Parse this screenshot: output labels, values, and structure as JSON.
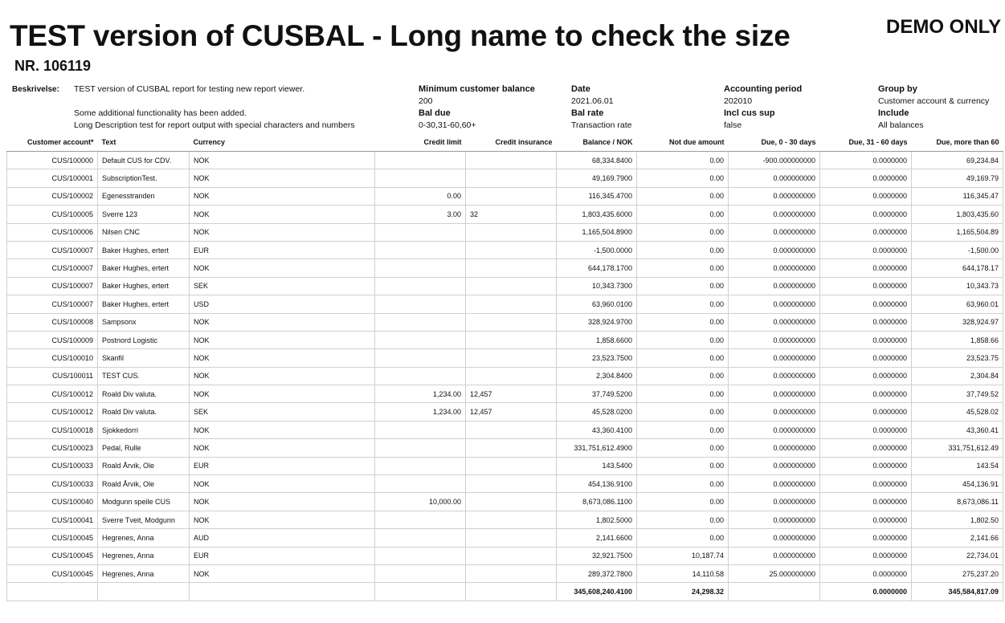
{
  "report": {
    "title": "TEST version of CUSBAL - Long name to check the size",
    "demo_label": "DEMO ONLY",
    "number": "NR. 106119"
  },
  "header": {
    "description_label": "Beskrivelse:",
    "description_lines": [
      "TEST version of CUSBAL report for testing new report viewer.",
      "",
      "Some additional functionality has been added.",
      "Long Description test for report output with special characters and numbers"
    ],
    "min_balance_label": "Minimum customer balance",
    "min_balance_value": "200",
    "bal_due_label": "Bal due",
    "bal_due_value": "0-30,31-60,60+",
    "date_label": "Date",
    "date_value": "2021.06.01",
    "bal_rate_label": "Bal rate",
    "bal_rate_value": "Transaction rate",
    "accounting_period_label": "Accounting period",
    "accounting_period_value": "202010",
    "incl_cus_sup_label": "Incl cus sup",
    "incl_cus_sup_value": "false",
    "group_by_label": "Group by",
    "group_by_value": "Customer account & currency",
    "include_label": "Include",
    "include_value": "All balances"
  },
  "table": {
    "columns": [
      "Customer account*",
      "Text",
      "Currency",
      "Credit limit",
      "Credit insurance",
      "Balance / NOK",
      "Not due amount",
      "Due, 0 - 30 days",
      "Due, 31 - 60 days",
      "Due, more than 60"
    ],
    "rows": [
      [
        "CUS/100000",
        "Default CUS for CDV.",
        "NOK",
        "",
        "",
        "68,334.8400",
        "0.00",
        "-900.000000000",
        "0.0000000",
        "69,234.84"
      ],
      [
        "CUS/100001",
        "SubscriptionTest.",
        "NOK",
        "",
        "",
        "49,169.7900",
        "0.00",
        "0.000000000",
        "0.0000000",
        "49,169.79"
      ],
      [
        "CUS/100002",
        "Egenesstranden",
        "NOK",
        "0.00",
        "",
        "116,345.4700",
        "0.00",
        "0.000000000",
        "0.0000000",
        "116,345.47"
      ],
      [
        "CUS/100005",
        "Sverre 123",
        "NOK",
        "3.00",
        "32",
        "1,803,435.6000",
        "0.00",
        "0.000000000",
        "0.0000000",
        "1,803,435.60"
      ],
      [
        "CUS/100006",
        "Nilsen CNC",
        "NOK",
        "",
        "",
        "1,165,504.8900",
        "0.00",
        "0.000000000",
        "0.0000000",
        "1,165,504.89"
      ],
      [
        "CUS/100007",
        "Baker Hughes, ertert",
        "EUR",
        "",
        "",
        "-1,500.0000",
        "0.00",
        "0.000000000",
        "0.0000000",
        "-1,500.00"
      ],
      [
        "CUS/100007",
        "Baker Hughes, ertert",
        "NOK",
        "",
        "",
        "644,178.1700",
        "0.00",
        "0.000000000",
        "0.0000000",
        "644,178.17"
      ],
      [
        "CUS/100007",
        "Baker Hughes, ertert",
        "SEK",
        "",
        "",
        "10,343.7300",
        "0.00",
        "0.000000000",
        "0.0000000",
        "10,343.73"
      ],
      [
        "CUS/100007",
        "Baker Hughes, ertert",
        "USD",
        "",
        "",
        "63,960.0100",
        "0.00",
        "0.000000000",
        "0.0000000",
        "63,960.01"
      ],
      [
        "CUS/100008",
        "Sampsonx",
        "NOK",
        "",
        "",
        "328,924.9700",
        "0.00",
        "0.000000000",
        "0.0000000",
        "328,924.97"
      ],
      [
        "CUS/100009",
        "Postnord Logistic",
        "NOK",
        "",
        "",
        "1,858.6600",
        "0.00",
        "0.000000000",
        "0.0000000",
        "1,858.66"
      ],
      [
        "CUS/100010",
        "Skanfil",
        "NOK",
        "",
        "",
        "23,523.7500",
        "0.00",
        "0.000000000",
        "0.0000000",
        "23,523.75"
      ],
      [
        "CUS/100011",
        "TEST CUS.",
        "NOK",
        "",
        "",
        "2,304.8400",
        "0.00",
        "0.000000000",
        "0.0000000",
        "2,304.84"
      ],
      [
        "CUS/100012",
        "Roald Div valuta.",
        "NOK",
        "1,234.00",
        "12,457",
        "37,749.5200",
        "0.00",
        "0.000000000",
        "0.0000000",
        "37,749.52"
      ],
      [
        "CUS/100012",
        "Roald Div valuta.",
        "SEK",
        "1,234.00",
        "12,457",
        "45,528.0200",
        "0.00",
        "0.000000000",
        "0.0000000",
        "45,528.02"
      ],
      [
        "CUS/100018",
        "Sjokkedorri",
        "NOK",
        "",
        "",
        "43,360.4100",
        "0.00",
        "0.000000000",
        "0.0000000",
        "43,360.41"
      ],
      [
        "CUS/100023",
        "Pedal, Rulle",
        "NOK",
        "",
        "",
        "331,751,612.4900",
        "0.00",
        "0.000000000",
        "0.0000000",
        "331,751,612.49"
      ],
      [
        "CUS/100033",
        "Roald Årvik, Ole",
        "EUR",
        "",
        "",
        "143.5400",
        "0.00",
        "0.000000000",
        "0.0000000",
        "143.54"
      ],
      [
        "CUS/100033",
        "Roald Årvik, Ole",
        "NOK",
        "",
        "",
        "454,136.9100",
        "0.00",
        "0.000000000",
        "0.0000000",
        "454,136.91"
      ],
      [
        "CUS/100040",
        "Modgunn speile CUS",
        "NOK",
        "10,000.00",
        "",
        "8,673,086.1100",
        "0.00",
        "0.000000000",
        "0.0000000",
        "8,673,086.11"
      ],
      [
        "CUS/100041",
        "Sverre Tveit, Modgunn",
        "NOK",
        "",
        "",
        "1,802.5000",
        "0.00",
        "0.000000000",
        "0.0000000",
        "1,802.50"
      ],
      [
        "CUS/100045",
        "Hegrenes, Anna",
        "AUD",
        "",
        "",
        "2,141.6600",
        "0.00",
        "0.000000000",
        "0.0000000",
        "2,141.66"
      ],
      [
        "CUS/100045",
        "Hegrenes, Anna",
        "EUR",
        "",
        "",
        "32,921.7500",
        "10,187.74",
        "0.000000000",
        "0.0000000",
        "22,734.01"
      ],
      [
        "CUS/100045",
        "Hegrenes, Anna",
        "NOK",
        "",
        "",
        "289,372.7800",
        "14,110.58",
        "25.000000000",
        "0.0000000",
        "275,237.20"
      ]
    ],
    "totals": [
      "",
      "",
      "",
      "",
      "",
      "345,608,240.4100",
      "24,298.32",
      "",
      "0.0000000",
      "345,584,817.09"
    ]
  }
}
